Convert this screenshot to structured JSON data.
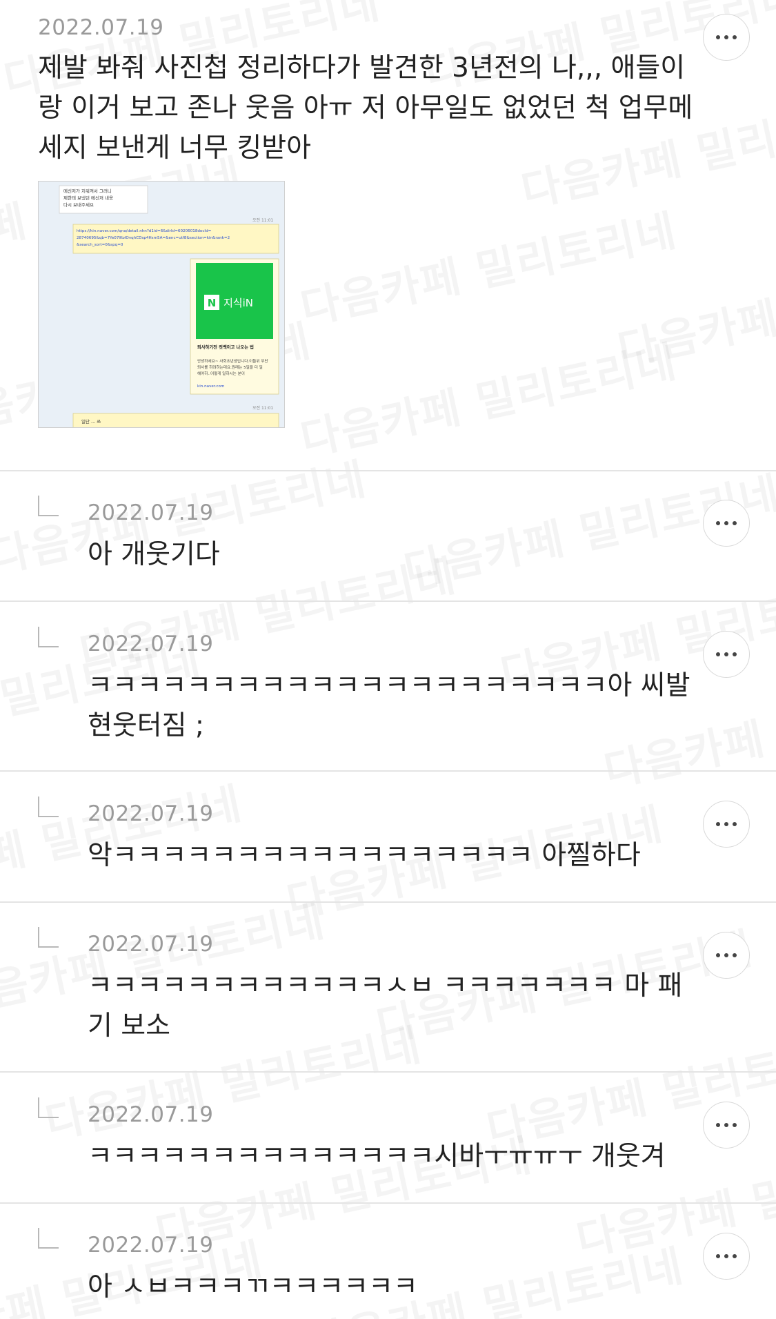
{
  "watermark": "다음카페 밀리토리네",
  "post": {
    "date": "2022.07.19",
    "text": "제발 봐줘 사진첩 정리하다가 발견한 3년전의 나,,, 애들이랑 이거 보고 존나 웃음 아ㅠ 저 아무일도 없었던 척 업무메세지 보낸게 너무 킹받아",
    "image": {
      "top_message": "메신저가 지워져서 그러니\n제한테 보냈던 메신저 내용\n다시 보내주세요",
      "time1": "오전 11:01",
      "link": "https://kin.naver.com/qna/detail.nhn?d1id=6&dirId=60206018docId=28740695&qb=7Ye07lKoIOvqhCDsp4Hsm5A=&enc=utf8&section=kin&rank=2&search_sort=0&spq=0",
      "card_logo": "N",
      "card_brand": "지식iN",
      "card_title": "퇴사하기전 컷백이고 나오는 법",
      "card_desc": "안녕하세요~ 사회초년생입니다.이들위 무단퇴사를 하려하는데요.원래는 5일을 더 일 해야하..어떻게 일하시는 분이",
      "card_url": "kin.naver.com",
      "time2": "오전 11:01",
      "bottom_text": "일단 ... 쓰"
    }
  },
  "replies": [
    {
      "date": "2022.07.19",
      "text": "아 개웃기다"
    },
    {
      "date": "2022.07.19",
      "text": "ㅋㅋㅋㅋㅋㅋㅋㅋㅋㅋㅋㅋㅋㅋㅋㅋㅋㅋㅋㅋㅋ아 씨발 현웃터짐 ;"
    },
    {
      "date": "2022.07.19",
      "text": "악ㅋㅋㅋㅋㅋㅋㅋㅋㅋㅋㅋㅋㅋㅋㅋㅋㅋ 아찔하다"
    },
    {
      "date": "2022.07.19",
      "text": "ㅋㅋㅋㅋㅋㅋㅋㅋㅋㅋㅋㅋㅅㅂ ㅋㅋㅋㅋㅋㅋㅋ 마 패기 보소"
    },
    {
      "date": "2022.07.19",
      "text": "ㅋㅋㅋㅋㅋㅋㅋㅋㅋㅋㅋㅋㅋㅋ시바ㅜㅠㅠㅜ 개웃겨"
    },
    {
      "date": "2022.07.19",
      "text": "아 ㅅㅂㅋㅋㅋㄲㅋㅋㅋㅋㅋㅋ"
    }
  ]
}
